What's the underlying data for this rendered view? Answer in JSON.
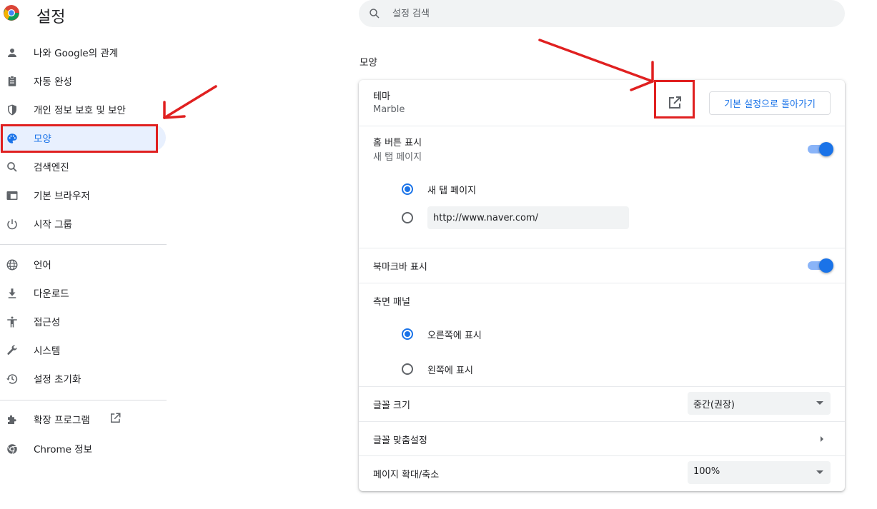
{
  "header": {
    "title": "설정",
    "search_placeholder": "설정 검색"
  },
  "sidebar": {
    "items": [
      {
        "label": "나와 Google의 관계",
        "icon": "person-icon"
      },
      {
        "label": "자동 완성",
        "icon": "clipboard-icon"
      },
      {
        "label": "개인 정보 보호 및 보안",
        "icon": "shield-icon"
      },
      {
        "label": "모양",
        "icon": "palette-icon",
        "active": true
      },
      {
        "label": "검색엔진",
        "icon": "search-icon"
      },
      {
        "label": "기본 브라우저",
        "icon": "browser-icon"
      },
      {
        "label": "시작 그룹",
        "icon": "power-icon"
      },
      {
        "label": "언어",
        "icon": "globe-icon"
      },
      {
        "label": "다운로드",
        "icon": "download-icon"
      },
      {
        "label": "접근성",
        "icon": "accessibility-icon"
      },
      {
        "label": "시스템",
        "icon": "wrench-icon"
      },
      {
        "label": "설정 초기화",
        "icon": "history-icon"
      },
      {
        "label": "확장 프로그램",
        "icon": "puzzle-icon"
      },
      {
        "label": "Chrome 정보",
        "icon": "chrome-icon"
      }
    ]
  },
  "appearance": {
    "section_title": "모양",
    "theme": {
      "label": "테마",
      "value": "Marble",
      "reset_label": "기본 설정으로 돌아가기"
    },
    "home_button": {
      "label": "홈 버튼 표시",
      "value": "새 탭 페이지",
      "enabled": true,
      "option_new_tab": "새 탭 페이지",
      "custom_url": "http://www.naver.com/"
    },
    "bookmarks_bar": {
      "label": "북마크바 표시",
      "enabled": true
    },
    "side_panel": {
      "label": "측면 패널",
      "option_right": "오른쪽에 표시",
      "option_left": "왼쪽에 표시"
    },
    "font_size": {
      "label": "글꼴 크기",
      "value": "중간(권장)"
    },
    "customize_fonts": {
      "label": "글꼴 맞춤설정"
    },
    "page_zoom": {
      "label": "페이지 확대/축소",
      "value": "100%"
    }
  },
  "colors": {
    "accent": "#1a73e8",
    "active_bg": "#e8f0fe",
    "annotation_red": "#e02020"
  }
}
